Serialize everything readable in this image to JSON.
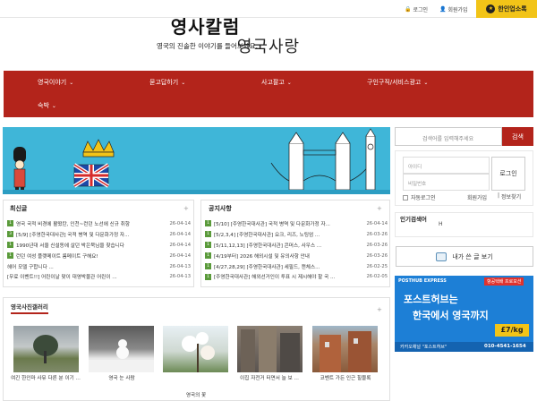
{
  "topbar": {
    "login": "로그인",
    "join": "회원가입",
    "badge": "한인업소록"
  },
  "site": {
    "title": "영국사랑"
  },
  "nav": [
    {
      "label": "영국이야기"
    },
    {
      "label": "묻고답하기"
    },
    {
      "label": "사고팔고"
    },
    {
      "label": "구인구직/서비스광고"
    },
    {
      "label": "숙박"
    }
  ],
  "banner": {
    "title": "영사칼럼",
    "subtitle": "영국의 진솔한 이야기를 들어보세요."
  },
  "search": {
    "placeholder": "검색어를 입력해주세요",
    "button": "검색"
  },
  "login": {
    "id_placeholder": "아이디",
    "pw_placeholder": "비밀번호",
    "button": "로그인",
    "auto": "자동로그인",
    "join": "회원가입",
    "find": "정보찾기"
  },
  "popular": {
    "title": "인기검색어",
    "value": "H"
  },
  "write_button": "내가 쓴 글 보기",
  "ad": {
    "top_left": "POSTHUB EXPRESS",
    "top_right": "항공택배 프로모션",
    "line1": "포스트허브는",
    "line2": "한국에서 영국까지",
    "price": "£7/kg",
    "bottom_left": "카카오채널 \"포스트허브\"",
    "phone": "010-4541-1654"
  },
  "recent": {
    "title": "최신글",
    "more": "+",
    "items": [
      {
        "num": "1",
        "text": "영국 국적 비경에 활떴탄, 인천~런던 노선에 신규 취항",
        "date": "26-04-14"
      },
      {
        "num": "3",
        "text": "[5/9] [주영한국대사관] 국적 병역 및 다문화가정 자...",
        "date": "26-04-14"
      },
      {
        "num": "1",
        "text": "1990년대 서울 신설동에 살던 박은묵님을 찾습니다",
        "date": "26-04-14"
      },
      {
        "num": "1",
        "text": "런던 여성 플랫메이트 룸메이트 구해요!",
        "date": "26-04-14"
      },
      {
        "num": "",
        "text": "헤어 모델 구합니다 ...",
        "date": "26-04-13"
      },
      {
        "num": "",
        "text": "[무료 이벤트!!] 어린이날 맞이 대영박물관 어린이 ...",
        "date": "26-04-13"
      }
    ]
  },
  "notice": {
    "title": "공지사항",
    "more": "+",
    "items": [
      {
        "num": "1",
        "text": "[5/10] [주영한국대사관] 국적 병역 및 다문화가정 자...",
        "date": "26-04-14"
      },
      {
        "num": "1",
        "text": "[5/2,3,4] [주영한국대사관] 요크, 리즈, 노팅엄 ...",
        "date": "26-03-26"
      },
      {
        "num": "1",
        "text": "[5/11,12,13] [주영한국대사관] 콘머스, 사우스 ...",
        "date": "26-03-26"
      },
      {
        "num": "1",
        "text": "[4/19부터] 2026 해외시설 및 유의사항 안내",
        "date": "26-03-26"
      },
      {
        "num": "1",
        "text": "[4/27,28,29] [주영한국대사관] 세필드, 캔체스...",
        "date": "26-02-25"
      },
      {
        "num": "1",
        "text": "[주영한국대사관] 해외선거인이 투표 시 제시해야 할 국 ...",
        "date": "26-02-05"
      }
    ]
  },
  "photos": {
    "title": "영국사진갤러리",
    "more": "+",
    "items": [
      {
        "caption": "여긴 한인마 사뮤 다른 분 이기 ..."
      },
      {
        "caption": "영국 눈 사람"
      },
      {
        "caption": "영국의 꽃"
      },
      {
        "caption": "이집 자전거 터면서 늘 보 ..."
      },
      {
        "caption": "코벤트 가든 인근 힐블록"
      }
    ]
  },
  "colors": {
    "nav": "#b3241b",
    "banner": "#3fb6d8",
    "badge": "#f2c418",
    "ad": "#1d7fd6"
  }
}
